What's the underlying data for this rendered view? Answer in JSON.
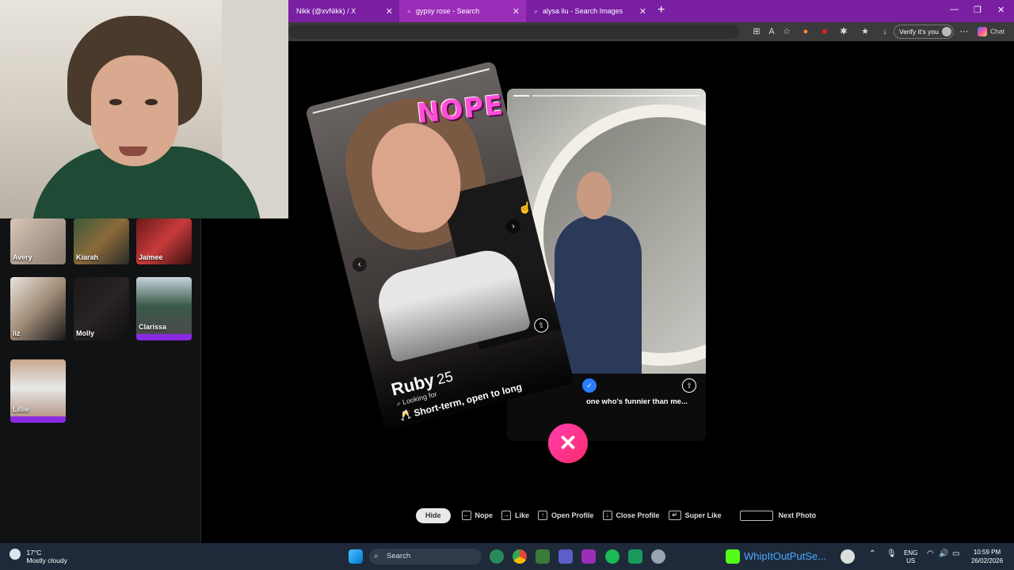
{
  "browser": {
    "tabs": [
      {
        "title": "Nikk (@xvNikk) / X"
      },
      {
        "title": "gypsy rose - Search"
      },
      {
        "title": "alysa liu - Search Images"
      }
    ],
    "verify_label": "Verify it's you",
    "chat_label": "Chat"
  },
  "matches": [
    {
      "name": "Avery"
    },
    {
      "name": "Kiarah"
    },
    {
      "name": "Jaimee"
    },
    {
      "name": "liz"
    },
    {
      "name": "Molly"
    },
    {
      "name": "Clarissa"
    },
    {
      "name": "Lillie"
    }
  ],
  "front_card": {
    "stamp": "NOPE",
    "name": "Ruby",
    "age": "25",
    "looking_for_label": "Looking for",
    "looking_for_value": "Short-term, open to long"
  },
  "back_card": {
    "caption": "one who's funnier than me..."
  },
  "hints": {
    "hide": "Hide",
    "nope": "Nope",
    "like": "Like",
    "open_profile": "Open Profile",
    "close_profile": "Close Profile",
    "super_like": "Super Like",
    "next_photo": "Next Photo"
  },
  "taskbar": {
    "temp": "17°C",
    "weather": "Mostly cloudy",
    "search": "Search",
    "media_title": "WhipItOutPutSe...",
    "lang_top": "ENG",
    "lang_bottom": "US",
    "time": "10:59 PM",
    "date": "26/02/2026"
  },
  "colors": {
    "tab_bar": "#7a1fa2",
    "nope_pink": "#ff3fb0",
    "match_new": "#8a2be2"
  }
}
